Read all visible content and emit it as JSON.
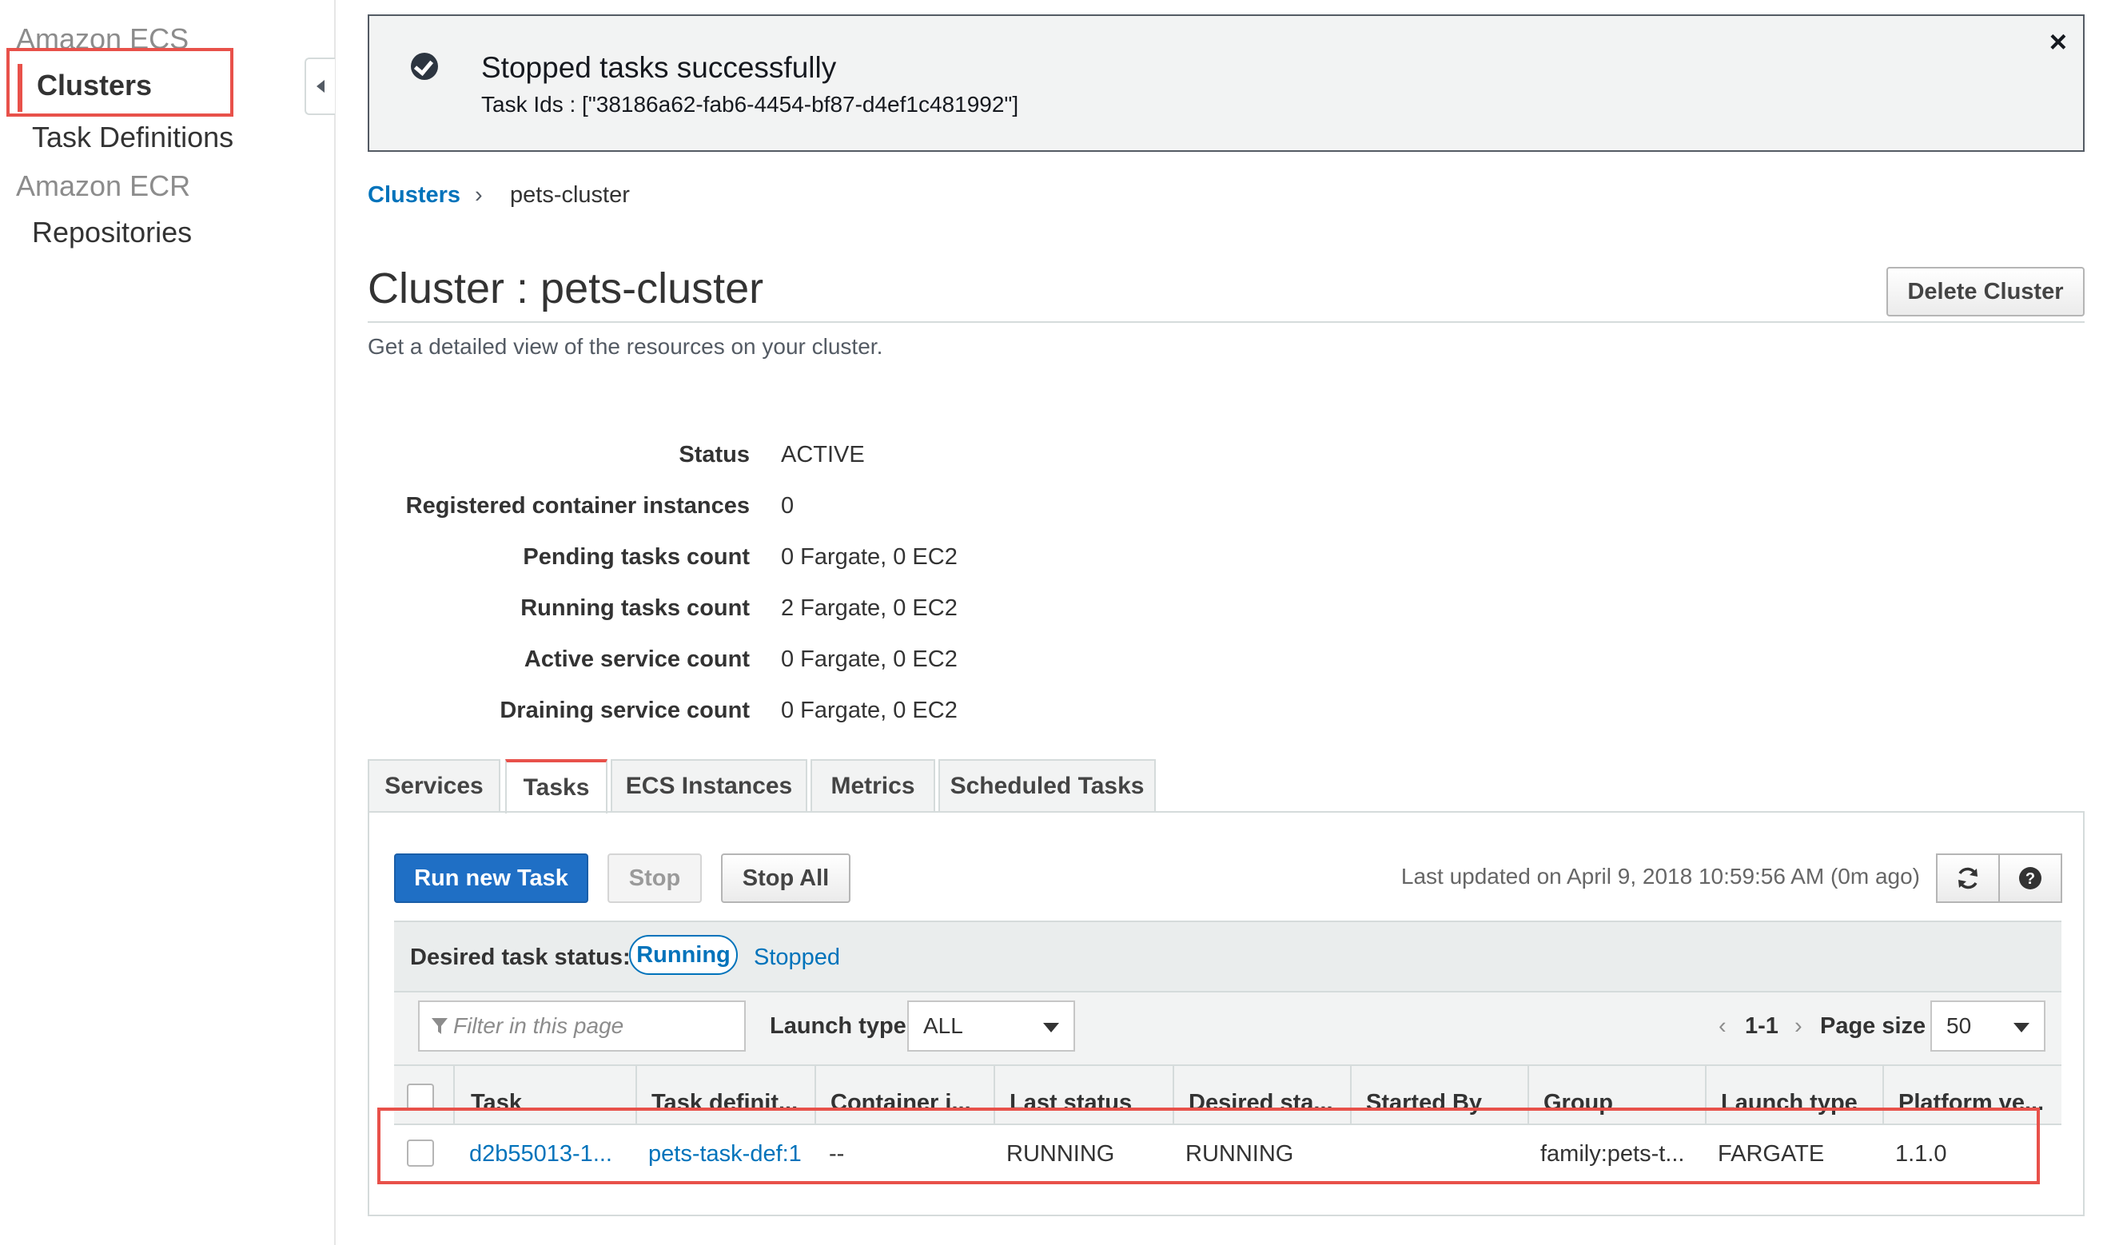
{
  "sidebar": {
    "section_ecs": "Amazon ECS",
    "clusters": "Clusters",
    "task_definitions": "Task Definitions",
    "section_ecr": "Amazon ECR",
    "repositories": "Repositories"
  },
  "flash": {
    "title": "Stopped tasks successfully",
    "detail": "Task Ids : [\"38186a62-fab6-4454-bf87-d4ef1c481992\"]",
    "close": "×"
  },
  "breadcrumb": {
    "root": "Clusters",
    "separator": "›",
    "current": "pets-cluster"
  },
  "page": {
    "title": "Cluster : pets-cluster",
    "subtitle": "Get a detailed view of the resources on your cluster.",
    "delete_button": "Delete Cluster"
  },
  "details": [
    {
      "label": "Status",
      "value": "ACTIVE"
    },
    {
      "label": "Registered container instances",
      "value": "0"
    },
    {
      "label": "Pending tasks count",
      "value": "0 Fargate, 0 EC2"
    },
    {
      "label": "Running tasks count",
      "value": "2 Fargate, 0 EC2"
    },
    {
      "label": "Active service count",
      "value": "0 Fargate, 0 EC2"
    },
    {
      "label": "Draining service count",
      "value": "0 Fargate, 0 EC2"
    }
  ],
  "tabs": [
    "Services",
    "Tasks",
    "ECS Instances",
    "Metrics",
    "Scheduled Tasks"
  ],
  "toolbar": {
    "run_new_task": "Run new Task",
    "stop": "Stop",
    "stop_all": "Stop All",
    "last_updated": "Last updated on April 9, 2018 10:59:56 AM (0m ago)"
  },
  "status_filter": {
    "label": "Desired task status:",
    "running": "Running",
    "stopped": "Stopped"
  },
  "filters": {
    "filter_placeholder": "Filter in this page",
    "launch_type_label": "Launch type",
    "launch_type_value": "ALL",
    "pagination": "1-1",
    "prev": "‹",
    "next": "›",
    "page_size_label": "Page size",
    "page_size_value": "50"
  },
  "table": {
    "columns": [
      "Task",
      "Task definit...",
      "Container i...",
      "Last status",
      "Desired sta...",
      "Started By",
      "Group",
      "Launch type",
      "Platform ve..."
    ],
    "rows": [
      [
        "d2b55013-1...",
        "pets-task-def:1",
        "--",
        "RUNNING",
        "RUNNING",
        "",
        "family:pets-t...",
        "FARGATE",
        "1.1.0"
      ]
    ]
  },
  "colors": {
    "accent_blue": "#0073bb",
    "primary_button": "#1f6fc5",
    "highlight_red": "#e8514a"
  },
  "icons": {
    "success": "check-circle-icon",
    "refresh": "refresh-icon",
    "help": "help-icon",
    "filter": "filter-icon",
    "collapse": "caret-left-icon"
  }
}
